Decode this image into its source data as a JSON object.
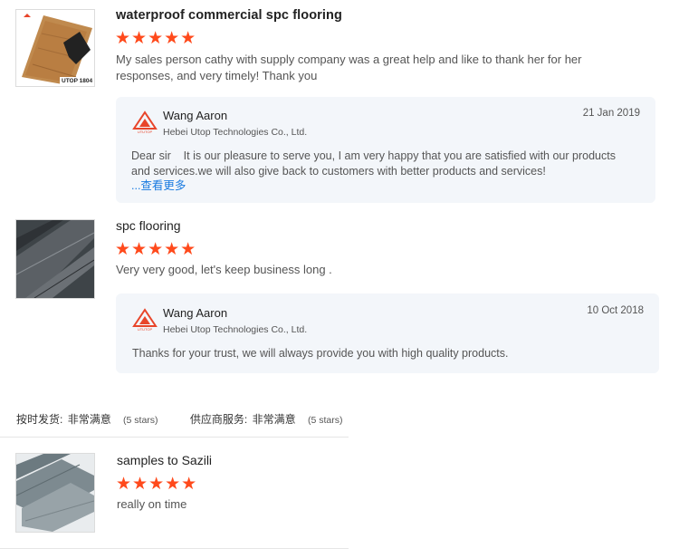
{
  "reviews": [
    {
      "title": "waterproof commercial spc flooring",
      "stars": "★★★★★",
      "text": "My sales person cathy with supply company was a great help and like to thank her for her responses, and very timely! Thank you",
      "thumb_caption": "UTOP 1804",
      "reply": {
        "name": "Wang Aaron",
        "company": "Hebei Utop Technologies Co., Ltd.",
        "date": "21 Jan 2019",
        "body": "Dear sir    It is our pleasure to serve you, I am very happy that you are satisfied with our products and services.we will also give back to customers with better products and services!",
        "see_more": "...查看更多"
      }
    },
    {
      "title": "spc flooring",
      "stars": "★★★★★",
      "text": "Very very good, let's keep business long .",
      "reply": {
        "name": "Wang Aaron",
        "company": "Hebei Utop Technologies Co., Ltd.",
        "date": "10 Oct 2018",
        "body": "Thanks for your trust, we will always provide you with high quality products."
      }
    },
    {
      "title": "samples to Sazili",
      "stars": "★★★★★",
      "text": "really on time"
    }
  ],
  "ratings": {
    "delivery_label": "按时发货:",
    "delivery_value": "非常满意",
    "delivery_stars": "(5 stars)",
    "service_label": "供应商服务:",
    "service_value": "非常满意",
    "service_stars": "(5 stars)"
  },
  "logo_text": "UTUTOP",
  "colors": {
    "star": "#ff4a1c",
    "link": "#1a7be0",
    "reply_bg": "#f3f6fa",
    "logo": "#e8452a"
  }
}
